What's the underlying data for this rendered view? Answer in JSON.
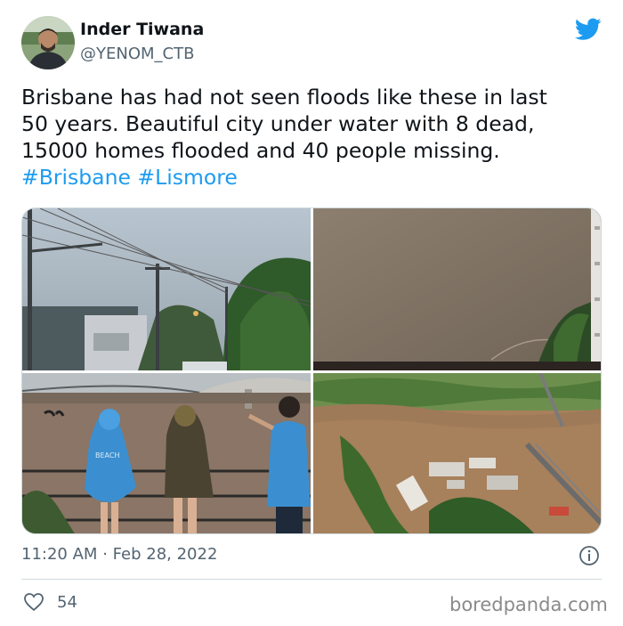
{
  "author": {
    "name": "Inder Tiwana",
    "handle": "@YENOM_CTB"
  },
  "tweet": {
    "lines": [
      "Brisbane has had not seen floods like these in last",
      "50 years. Beautiful city under water with 8 dead,",
      "15000 homes flooded and 40 people missing."
    ],
    "hashtags": [
      "#Brisbane",
      "#Lismore"
    ]
  },
  "media": {
    "count": 4,
    "hoodie_text": "BEACH"
  },
  "meta": {
    "time": "11:20 AM",
    "separator": "·",
    "date": "Feb 28, 2022"
  },
  "engagement": {
    "likes": "54"
  },
  "watermark": "boredpanda.com",
  "icons": {
    "brand": "twitter-bird-icon",
    "info": "info-icon",
    "like": "heart-icon"
  },
  "colors": {
    "accent": "#1d9bf0",
    "text": "#0f1419",
    "secondary": "#536471",
    "border": "#cfd9de"
  }
}
